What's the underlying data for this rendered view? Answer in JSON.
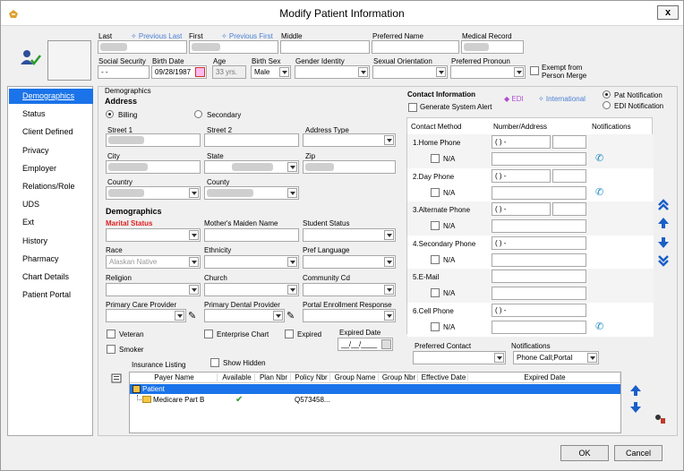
{
  "window": {
    "title": "Modify Patient Information",
    "close": "x"
  },
  "colors": {
    "accent": "#1a73e8",
    "link": "#4a7fd4",
    "required": "#e02020",
    "phone": "#1a8ac2",
    "edi": "#b04fd0",
    "check": "#2a9a2a"
  },
  "header": {
    "last_label": "Last",
    "previous_last": "✧ Previous Last",
    "first_label": "First",
    "previous_first": "✧ Previous First",
    "middle_label": "Middle",
    "preferred_name_label": "Preferred Name",
    "medical_record_label": "Medical Record",
    "ssn_label": "Social Security",
    "ssn_value": "- -",
    "birth_date_label": "Birth Date",
    "birth_date_value": "09/28/1987",
    "age_label": "Age",
    "age_value": "33 yrs.",
    "birth_sex_label": "Birth Sex",
    "birth_sex_value": "Male",
    "gender_identity_label": "Gender Identity",
    "sexual_orientation_label": "Sexual Orientation",
    "preferred_pronoun_label": "Preferred Pronoun",
    "exempt_label_1": "Exempt from",
    "exempt_label_2": "Person Merge"
  },
  "nav": {
    "items": [
      "Demographics",
      "Status",
      "Client Defined",
      "Privacy",
      "Employer",
      "Relations/Role",
      "UDS",
      "Ext",
      "History",
      "Pharmacy",
      "Chart Details",
      "Patient Portal"
    ]
  },
  "demographics": {
    "group_label": "Demographics",
    "address_heading": "Address",
    "billing": "Billing",
    "secondary": "Secondary",
    "street1": "Street 1",
    "street2": "Street 2",
    "address_type": "Address Type",
    "city": "City",
    "state": "State",
    "zip": "Zip",
    "country": "Country",
    "county": "County",
    "demo_heading": "Demographics",
    "marital_status": "Marital Status",
    "maiden_name": "Mother's Maiden Name",
    "student_status": "Student Status",
    "race": "Race",
    "race_value": "Alaskan Native",
    "ethnicity": "Ethnicity",
    "pref_language": "Pref Language",
    "religion": "Religion",
    "church": "Church",
    "community": "Community Cd",
    "pcp": "Primary Care Provider",
    "pdp": "Primary Dental Provider",
    "portal_response": "Portal Enrollment Response",
    "veteran": "Veteran",
    "enterprise_chart": "Enterprise Chart",
    "expired": "Expired",
    "expired_date": "Expired Date",
    "expired_date_value": "__/__/____",
    "smoker": "Smoker"
  },
  "contact": {
    "heading": "Contact Information",
    "edi": "◆ EDI",
    "international": "✧ International",
    "pat_notification": "Pat Notification",
    "edi_notification": "EDI Notification",
    "generate_alert": "Generate System Alert",
    "col_method": "Contact Method",
    "col_number": "Number/Address",
    "col_notifications": "Notifications",
    "na": "N/A",
    "methods": [
      "1.Home Phone",
      "2.Day Phone",
      "3.Alternate Phone",
      "4.Secondary Phone",
      "5.E-Mail",
      "6.Cell Phone"
    ],
    "phone_placeholder": "(   )   -",
    "preferred_contact": "Preferred Contact",
    "notifications_label": "Notifications",
    "notifications_value": "Phone Call;Portal"
  },
  "insurance": {
    "label": "Insurance Listing",
    "show_hidden": "Show Hidden",
    "columns": [
      "Payer Name",
      "Available",
      "Plan Nbr",
      "Policy Nbr",
      "Group Name",
      "Group Nbr",
      "Effective Date",
      "Expired Date"
    ],
    "rows": [
      {
        "payer": "Patient",
        "policy": ""
      },
      {
        "payer": "Medicare Part B",
        "available": "✔",
        "policy": "Q573458..."
      }
    ]
  },
  "footer": {
    "ok": "OK",
    "cancel": "Cancel"
  }
}
